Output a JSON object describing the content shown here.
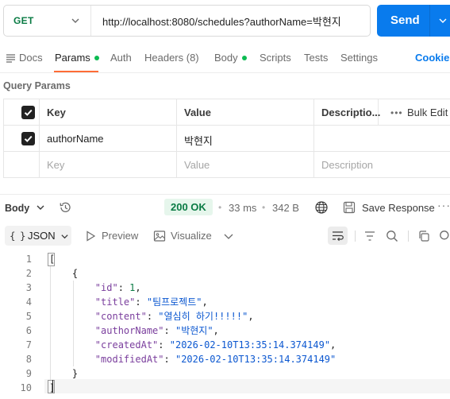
{
  "request": {
    "method": "GET",
    "url": "http://localhost:8080/schedules?authorName=박현지",
    "send_label": "Send"
  },
  "tabs": {
    "docs": "Docs",
    "params": "Params",
    "auth": "Auth",
    "headers": "Headers (8)",
    "body": "Body",
    "scripts": "Scripts",
    "tests": "Tests",
    "settings": "Settings",
    "cookies": "Cookies"
  },
  "query_params": {
    "title": "Query Params",
    "columns": {
      "key": "Key",
      "value": "Value",
      "description": "Descriptio...",
      "bulk_edit": "Bulk Edit"
    },
    "rows": [
      {
        "checked": true,
        "key": "authorName",
        "value": "박현지",
        "description": ""
      }
    ],
    "placeholder": {
      "key": "Key",
      "value": "Value",
      "description": "Description"
    }
  },
  "response": {
    "body_label": "Body",
    "status": "200 OK",
    "time": "33 ms",
    "size": "342 B",
    "save_label": "Save Response",
    "more": "···"
  },
  "format_bar": {
    "format": "JSON",
    "preview": "Preview",
    "visualize": "Visualize"
  },
  "code": {
    "line_numbers": [
      "1",
      "2",
      "3",
      "4",
      "5",
      "6",
      "7",
      "8",
      "9",
      "10"
    ],
    "record": {
      "id": 1,
      "title": "팀프로젝트",
      "content": "열심히 하기!!!!!",
      "authorName": "박현지",
      "createdAt": "2026-02-10T13:35:14.374149",
      "modifiedAt": "2026-02-10T13:35:14.374149"
    }
  },
  "colors": {
    "accent_blue": "#097bed",
    "status_green": "#0a7b44",
    "active_tab_underline": "#ff6c37",
    "dot_green": "#0cbb52"
  },
  "icons": [
    "chevron-down-icon",
    "history-icon",
    "globe-icon",
    "save-icon",
    "play-icon",
    "image-icon",
    "wrap-icon",
    "filter-icon",
    "search-icon",
    "copy-icon",
    "checkbox-icon"
  ]
}
